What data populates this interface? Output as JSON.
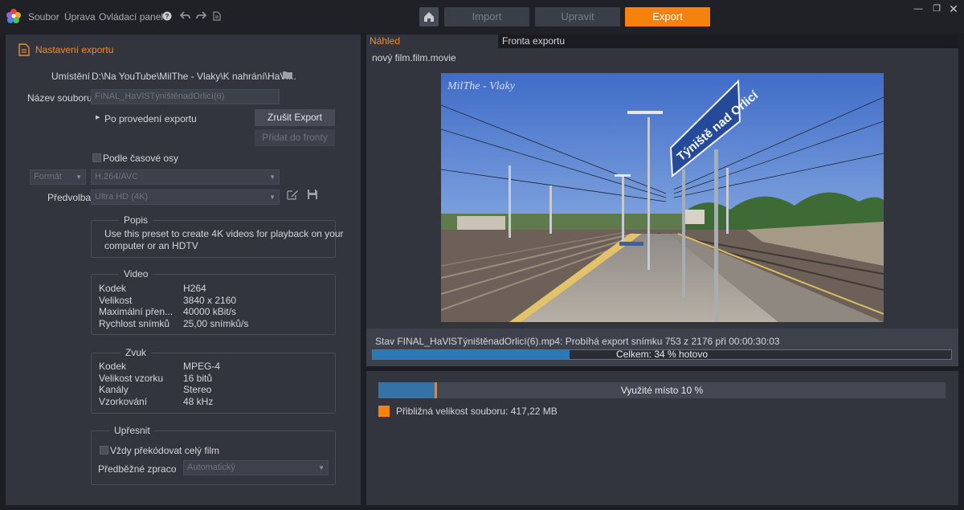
{
  "menu": {
    "file": "Soubor",
    "edit": "Úprava",
    "control_panel": "Ovládací panel"
  },
  "nav": {
    "import": "Import",
    "edit": "Upravit",
    "export": "Export"
  },
  "left": {
    "title": "Nastavení exportu",
    "location_label": "Umístění",
    "location_value": "D:\\Na YouTube\\MilThe - Vlaky\\K nahrání\\HaVl...",
    "filename_label": "Název souboru",
    "filename_value": "FINAL_HaVlSTýništěnadOrlicí(6)",
    "after_export": "Po provedení exportu",
    "cancel_export": "Zrušit Export",
    "add_to_queue": "Přidat do fronty",
    "timeline_checkbox": "Podle časové osy",
    "format_label": "Formát",
    "format_value": "H.264/AVC",
    "preset_label": "Předvolba",
    "preset_value": "Ultra HD (4K)",
    "description": {
      "title": "Popis",
      "text_line1": "Use this preset to create 4K videos for playback on your",
      "text_line2": "computer or an HDTV"
    },
    "video": {
      "title": "Video",
      "rows": [
        {
          "label": "Kodek",
          "value": "H264"
        },
        {
          "label": "Velikost",
          "value": "3840 x 2160"
        },
        {
          "label": "Maximální přen...",
          "value": "40000 kBit/s"
        },
        {
          "label": "Rychlost snímků",
          "value": "25,00 snímků/s"
        }
      ]
    },
    "audio": {
      "title": "Zvuk",
      "rows": [
        {
          "label": "Kodek",
          "value": "MPEG-4"
        },
        {
          "label": "Velikost vzorku",
          "value": "16 bitů"
        },
        {
          "label": "Kanály",
          "value": "Stereo"
        },
        {
          "label": "Vzorkování",
          "value": "48 kHz"
        }
      ]
    },
    "refine": {
      "title": "Upřesnit",
      "always_recode": "Vždy překódovat celý film",
      "prerender_label": "Předběžné zpraco",
      "prerender_value": "Automatický"
    }
  },
  "right": {
    "tabs": {
      "preview": "Náhled",
      "queue": "Fronta exportu"
    },
    "file_title": "nový film.film.movie",
    "watermark": "MilThe - Vlaky",
    "sign_text": "Týniště nad Orlicí",
    "status_text": "Stav FINAL_HaVlSTýništěnadOrlicí(6).mp4: Probíhá export snímku 753 z 2176 při 00:00:30:03",
    "progress_label": "Celkem: 34 % hotovo",
    "progress_fraction": 0.34,
    "disk_label": "Využité místo 10 %",
    "disk_fraction": 0.1,
    "size_label": "Přibližná velikost souboru: 417,22 MB"
  },
  "colors": {
    "accent": "#f5820d",
    "progress": "#2b77b8",
    "panel": "#32353e"
  }
}
